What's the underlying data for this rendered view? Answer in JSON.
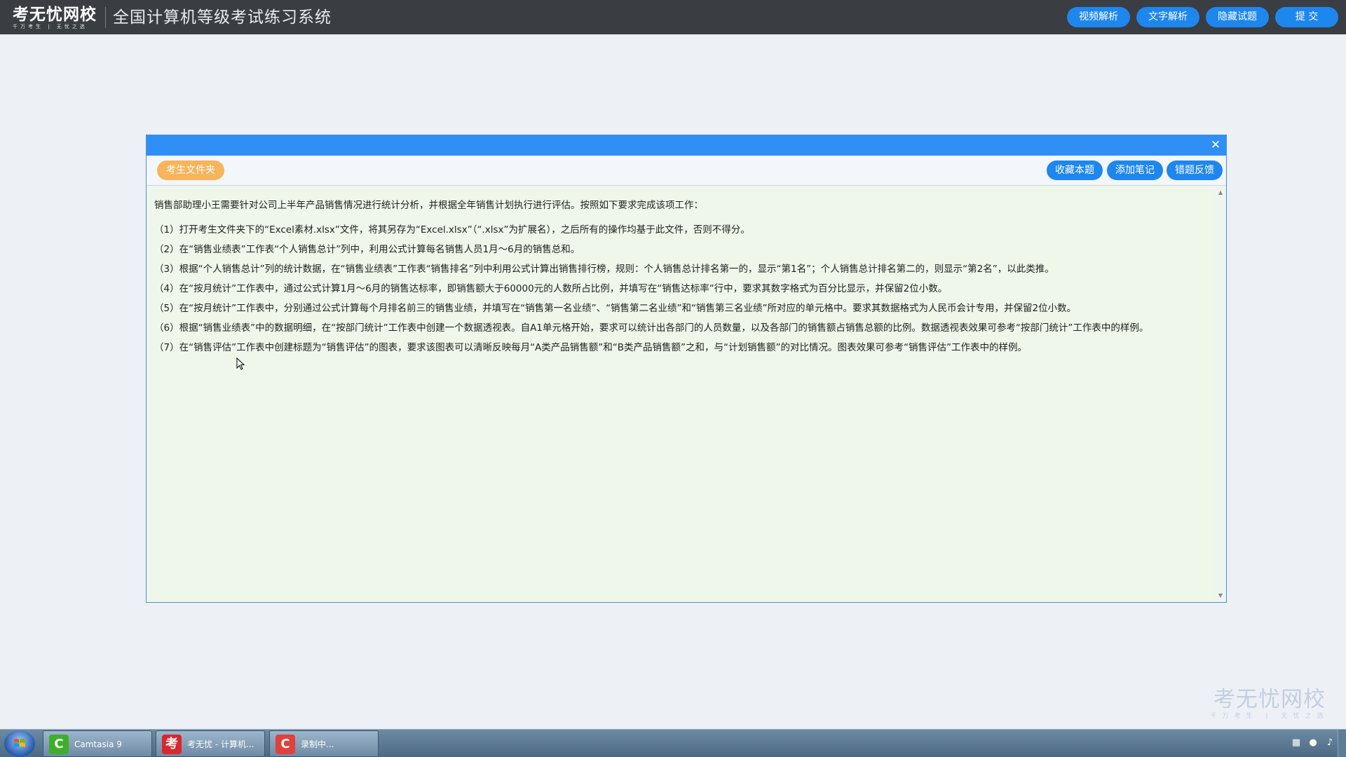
{
  "header": {
    "logo_text": "考无忧网校",
    "logo_subtext": "千万考生 | 无忧之选",
    "app_title": "全国计算机等级考试练习系统",
    "buttons": {
      "video": "视频解析",
      "text": "文字解析",
      "hide": "隐藏试题",
      "submit": "提  交"
    }
  },
  "dialog": {
    "close_icon": "close-icon",
    "toolbar": {
      "folder": "考生文件夹",
      "favorite": "收藏本题",
      "note": "添加笔记",
      "feedback": "错题反馈"
    },
    "intro": "销售部助理小王需要针对公司上半年产品销售情况进行统计分析，并根据全年销售计划执行进行评估。按照如下要求完成该项工作：",
    "items": [
      "（1）打开考生文件夹下的“Excel素材.xlsx”文件，将其另存为“Excel.xlsx”（“.xlsx”为扩展名），之后所有的操作均基于此文件，否则不得分。",
      "（2）在“销售业绩表”工作表“个人销售总计”列中，利用公式计算每名销售人员1月～6月的销售总和。",
      "（3）根据“个人销售总计”列的统计数据，在“销售业绩表”工作表“销售排名”列中利用公式计算出销售排行榜，规则：个人销售总计排名第一的，显示“第1名”；个人销售总计排名第二的，则显示“第2名”，以此类推。",
      "（4）在“按月统计”工作表中，通过公式计算1月～6月的销售达标率，即销售额大于60000元的人数所占比例，并填写在“销售达标率”行中，要求其数字格式为百分比显示，并保留2位小数。",
      "（5）在“按月统计”工作表中，分别通过公式计算每个月排名前三的销售业绩，并填写在“销售第一名业绩”、“销售第二名业绩”和“销售第三名业绩”所对应的单元格中。要求其数据格式为人民币会计专用，并保留2位小数。",
      "（6）根据“销售业绩表”中的数据明细，在“按部门统计”工作表中创建一个数据透视表。自A1单元格开始，要求可以统计出各部门的人员数量，以及各部门的销售额占销售总额的比例。数据透视表效果可参考“按部门统计”工作表中的样例。",
      "（7）在“销售评估”工作表中创建标题为“销售评估”的图表，要求该图表可以清晰反映每月“A类产品销售额”和“B类产品销售额”之和，与“计划销售额”的对比情况。图表效果可参考“销售评估”工作表中的样例。"
    ]
  },
  "watermark": {
    "main": "考无忧网校",
    "sub": "千万考生 | 无忧之选"
  },
  "taskbar": {
    "items": [
      {
        "label": "Camtasia 9",
        "icon": "camtasia-icon",
        "icon_glyph": "C",
        "color": "#3fae2a"
      },
      {
        "label": "考无忧 - 计算机...",
        "icon": "kaowuyou-icon",
        "icon_glyph": "考",
        "color": "#d9272e"
      },
      {
        "label": "录制中...",
        "icon": "recording-icon",
        "icon_glyph": "C",
        "color": "#e0413c"
      }
    ]
  }
}
